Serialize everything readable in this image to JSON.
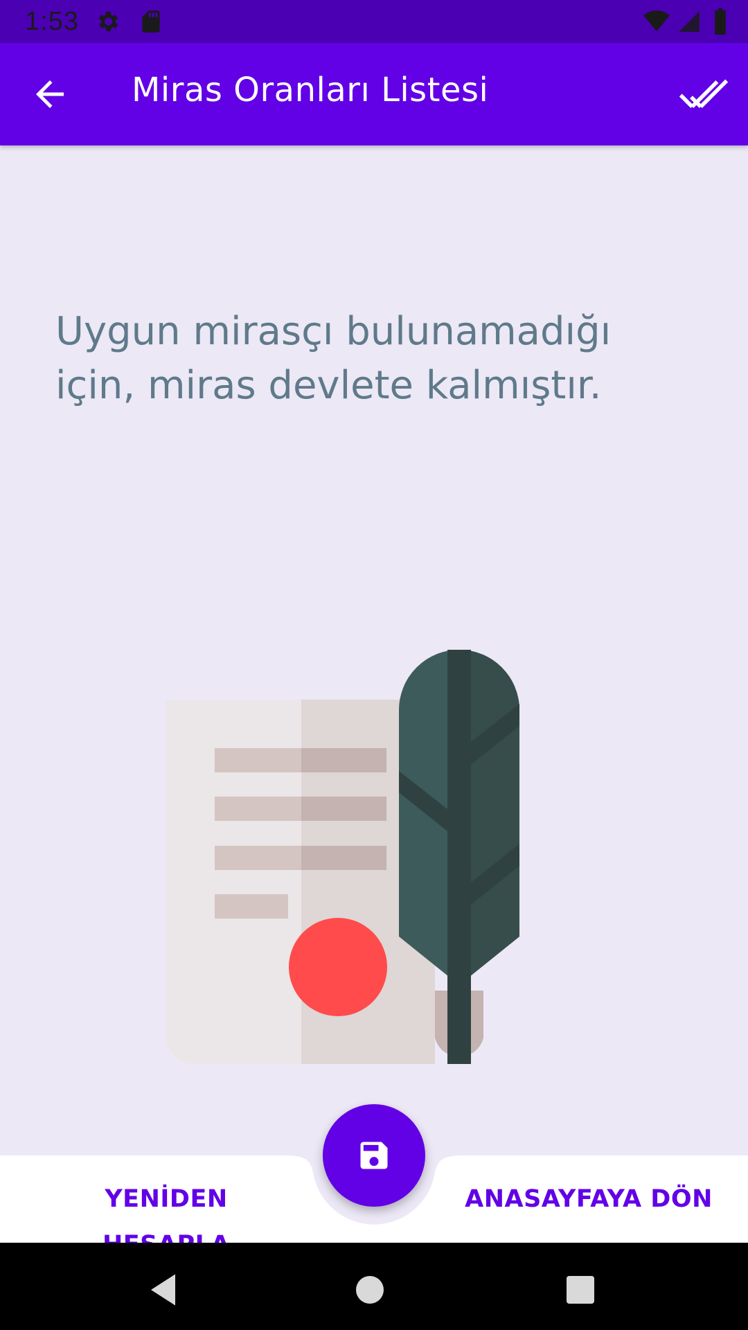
{
  "status_bar": {
    "time": "1:53",
    "icons": [
      "settings-icon",
      "sd-card-icon",
      "wifi-icon",
      "signal-icon",
      "battery-icon"
    ]
  },
  "app_bar": {
    "title": "Miras Oranları Listesi",
    "left_icon": "arrow-back-icon",
    "right_icon": "done-all-icon"
  },
  "main": {
    "message": "Uygun mirasçı bulunamadığı için, miras devlete kalmıştır."
  },
  "bottom_bar": {
    "left_button_label": "YENİDEN HESAPLA",
    "right_button_label": "ANASAYFAYA DÖN",
    "fab_icon": "save-icon"
  },
  "nav_bar": {
    "icons": [
      "nav-back-icon",
      "nav-home-icon",
      "nav-recents-icon"
    ]
  },
  "colors": {
    "status_bar": "#4b00b3",
    "primary": "#6200e6",
    "background": "#ede8f6",
    "message_text": "#5f7a8a"
  }
}
